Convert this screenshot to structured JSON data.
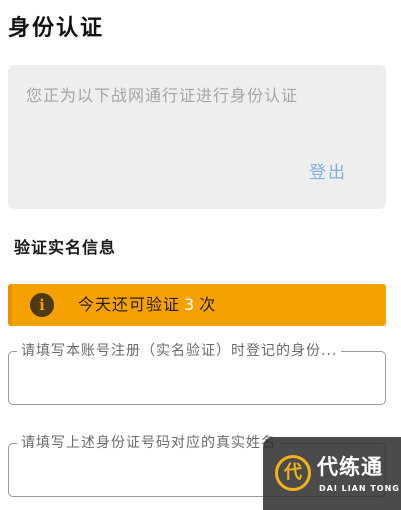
{
  "page": {
    "title": "身份认证"
  },
  "info_card": {
    "message": "您正为以下战网通行证进行身份认证",
    "logout_label": "登出"
  },
  "verification": {
    "section_title": "验证实名信息",
    "banner": {
      "icon": "info-icon",
      "icon_glyph": "i",
      "text_before": "今天还可验证",
      "count": "3",
      "text_after": "次",
      "background_color": "#f5a200"
    },
    "fields": {
      "account": {
        "label": "请填写本账号注册（实名验证）时登记的身份...",
        "value": ""
      },
      "name": {
        "label": "请填写上述身份证号码对应的真实姓名",
        "value": ""
      }
    }
  },
  "watermark": {
    "logo_glyph": "代",
    "text_cn": "代练通",
    "text_en": "DAI LIAN TONG"
  },
  "colors": {
    "accent_link": "#7fb0e6",
    "card_background": "#eeeeee",
    "banner": "#f5a200"
  }
}
